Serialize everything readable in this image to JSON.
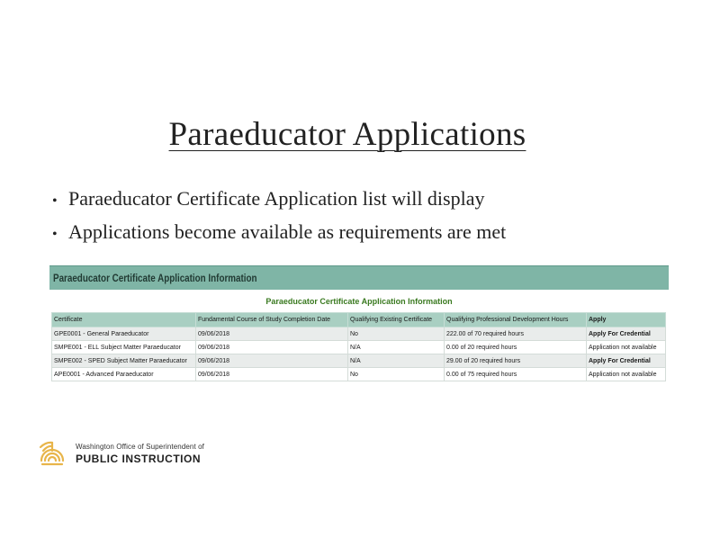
{
  "slide": {
    "title": "Paraeducator Applications",
    "bullets": [
      "Paraeducator Certificate Application list will display",
      "Applications become available as requirements are met"
    ],
    "bullet_marker": "•"
  },
  "panel": {
    "header": "Paraeducator Certificate Application Information",
    "caption": "Paraeducator Certificate Application Information",
    "header_color": "#7fb5a6",
    "caption_color": "#3a7a20",
    "columns": [
      "Certificate",
      "Fundamental Course of Study Completion Date",
      "Qualifying Existing Certificate",
      "Qualifying Professional Development Hours",
      "Apply"
    ],
    "rows": [
      [
        "GPE0001 - General Paraeducator",
        "09/06/2018",
        "No",
        "222.00 of 70 required hours",
        "Apply For Credential"
      ],
      [
        "SMPE001 - ELL Subject Matter Paraeducator",
        "09/06/2018",
        "N/A",
        "0.00 of 20 required hours",
        "Application not available"
      ],
      [
        "SMPE002 - SPED Subject Matter Paraeducator",
        "09/06/2018",
        "N/A",
        "29.00 of 20 required hours",
        "Apply For Credential"
      ],
      [
        "APE0001 - Advanced Paraeducator",
        "09/06/2018",
        "No",
        "0.00 of 75 required hours",
        "Application not available"
      ]
    ]
  },
  "logo": {
    "line1": "Washington Office of Superintendent of",
    "line2": "PUBLIC INSTRUCTION",
    "mark_color": "#e8b54a",
    "icon": "ospi-sun-logo-icon"
  }
}
